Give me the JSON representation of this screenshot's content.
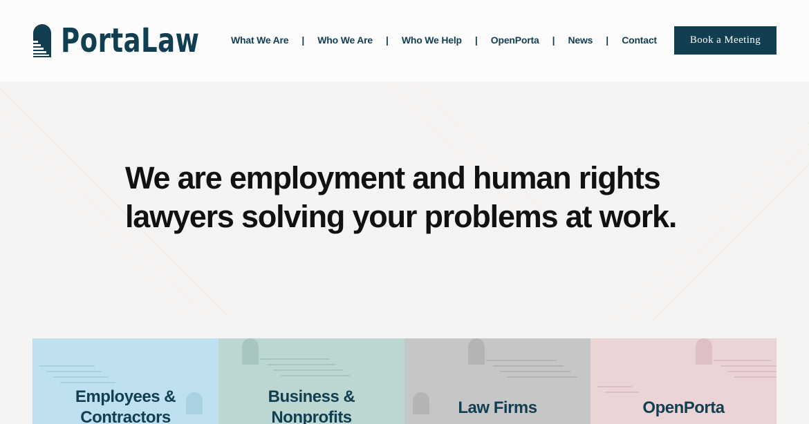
{
  "header": {
    "logo_text": "PortaLaw",
    "nav": [
      "What We Are",
      "Who We Are",
      "Who We Help",
      "OpenPorta",
      "News",
      "Contact"
    ],
    "separator": "|",
    "cta_label": "Book a Meeting"
  },
  "hero": {
    "title_line1": "We are employment and human rights",
    "title_line2": "lawyers solving your problems at work."
  },
  "cards": [
    {
      "line1": "Employees &",
      "line2": "Contractors",
      "color": "#bfe0ee"
    },
    {
      "line1": "Business &",
      "line2": "Nonprofits",
      "color": "#bcd7d1"
    },
    {
      "line1": "Law Firms",
      "color": "#c5c6c7"
    },
    {
      "line1": "OpenPorta",
      "color": "#ead4d6"
    }
  ],
  "colors": {
    "brand_navy": "#123e52",
    "header_bg": "#fbfcfb",
    "hero_bg": "#f6f4f3"
  },
  "icons": {
    "logo_mark": "portal-stairs-icon"
  }
}
